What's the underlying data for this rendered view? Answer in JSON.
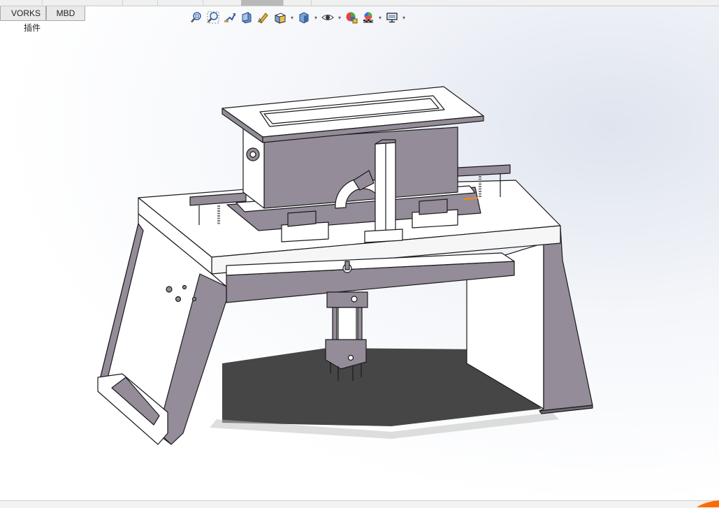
{
  "tabs": [
    {
      "label": "VORKS 插件"
    },
    {
      "label": "MBD"
    }
  ],
  "hud_icons": [
    {
      "name": "zoom-to-fit-icon",
      "has_dropdown": false
    },
    {
      "name": "zoom-to-area-icon",
      "has_dropdown": false
    },
    {
      "name": "previous-view-icon",
      "has_dropdown": false
    },
    {
      "name": "section-view-icon",
      "has_dropdown": false
    },
    {
      "name": "dynamic-annotation-views-icon",
      "has_dropdown": false
    },
    {
      "name": "view-orientation-icon",
      "has_dropdown": true
    },
    {
      "name": "display-style-icon",
      "has_dropdown": true
    },
    {
      "name": "hide-show-items-icon",
      "has_dropdown": true
    },
    {
      "name": "edit-appearance-icon",
      "has_dropdown": false
    },
    {
      "name": "apply-scene-icon",
      "has_dropdown": true
    },
    {
      "name": "view-settings-icon",
      "has_dropdown": true
    }
  ],
  "colors": {
    "part_face_dark": "#948c98",
    "part_face_light": "#ffffff",
    "edge": "#1a1a1a",
    "shadow": "#3c3c3c",
    "accent_orange": "#ff8c00"
  }
}
